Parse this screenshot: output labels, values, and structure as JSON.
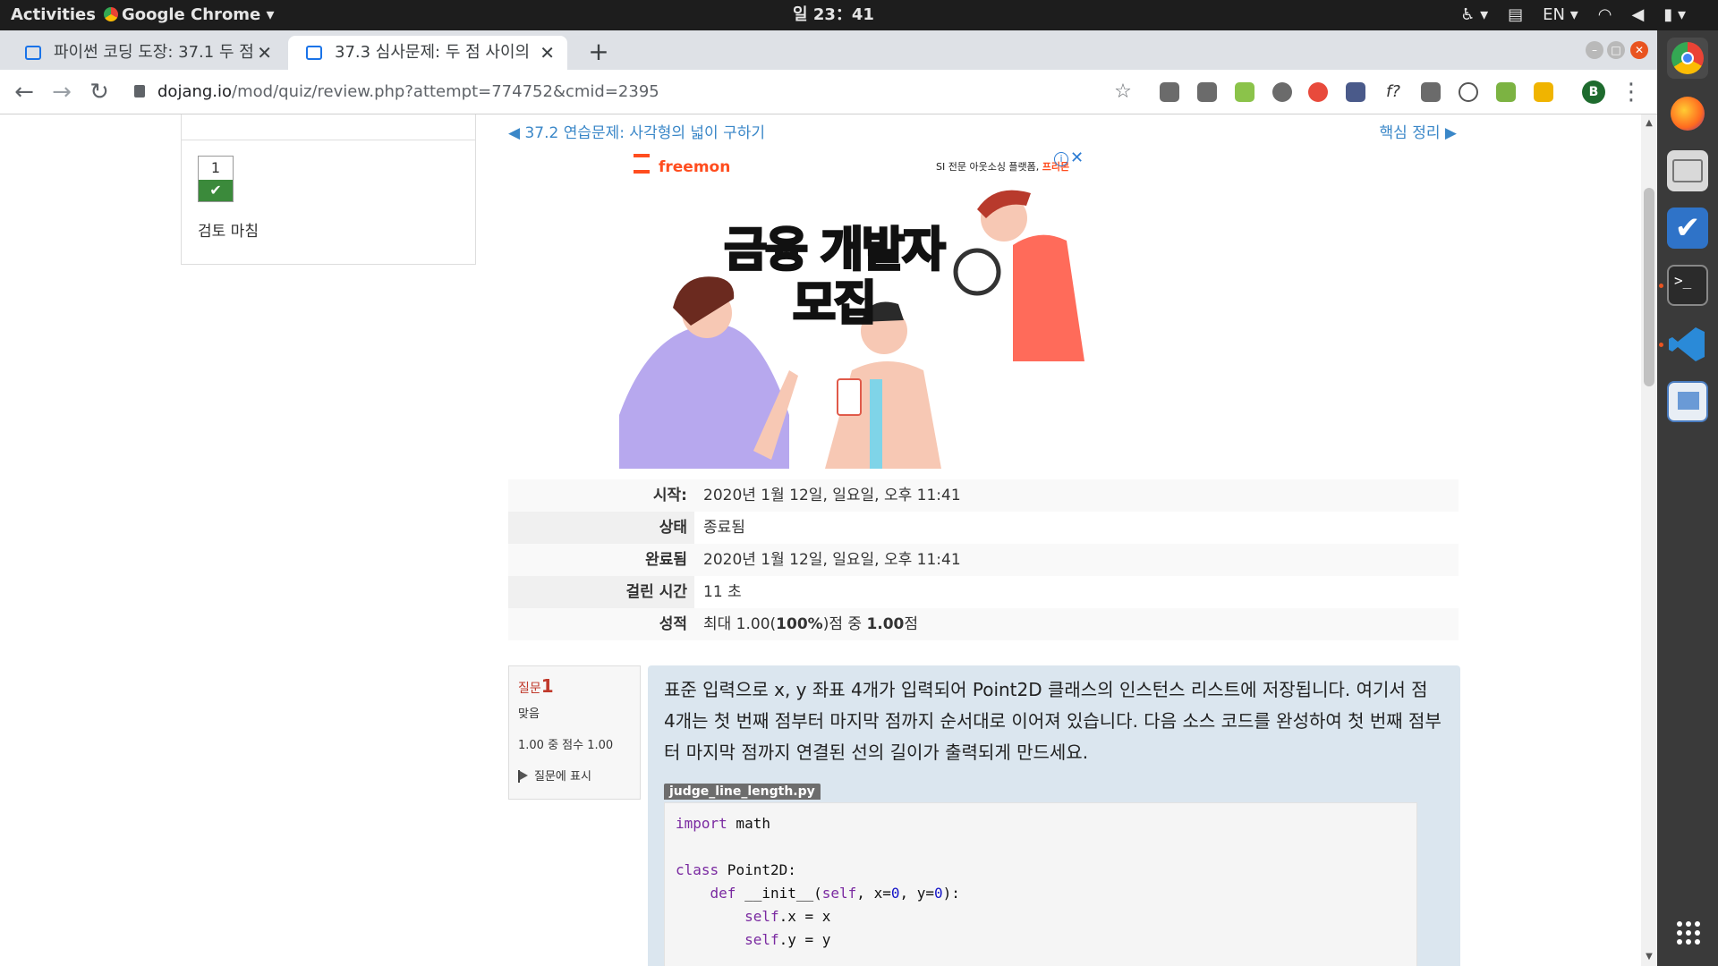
{
  "topbar": {
    "activities": "Activities",
    "app_name": "Google Chrome",
    "clock": "일 23：41",
    "lang": "EN"
  },
  "tabs": [
    {
      "label": "파이썬 코딩 도장: 37.1 두 점",
      "active": false
    },
    {
      "label": "37.3 심사문제: 두 점 사이의",
      "active": true
    }
  ],
  "address": {
    "host": "dojang.io",
    "path": "/mod/quiz/review.php?attempt=774752&cmid=2395"
  },
  "profile_initial": "B",
  "nav_panel": {
    "question_number": "1",
    "finish_review": "검토 마침"
  },
  "pager": {
    "prev": "◀ 37.2 연습문제: 사각형의 넓이 구하기",
    "next": "핵심 정리 ▶"
  },
  "ad": {
    "brand": "freemon",
    "tagline_prefix": "SI 전문 아웃소싱 플랫폼,",
    "tagline_brand": "프리몬",
    "headline_line1": "금융 개발자",
    "headline_line2": "모집"
  },
  "summary": [
    {
      "label": "시작:",
      "value": "2020년 1월 12일, 일요일, 오후 11:41"
    },
    {
      "label": "상태",
      "value": "종료됨"
    },
    {
      "label": "완료됨",
      "value": "2020년 1월 12일, 일요일, 오후 11:41"
    },
    {
      "label": "걸린 시간",
      "value": "11 초"
    }
  ],
  "grade_row": {
    "label": "성적",
    "prefix": "최대 1.00(",
    "percent": "100%",
    "middle": ")점 중 ",
    "score": "1.00",
    "suffix": "점"
  },
  "question_info": {
    "label": "질문",
    "number": "1",
    "state": "맞음",
    "grade": "1.00 중 점수 1.00",
    "flag": "질문에 표시"
  },
  "question": {
    "text": "표준 입력으로 x, y 좌표 4개가 입력되어 Point2D 클래스의 인스턴스 리스트에 저장됩니다. 여기서 점 4개는 첫 번째 점부터 마지막 점까지 순서대로 이어져 있습니다. 다음 소스 코드를 완성하여 첫 번째 점부터 마지막 점까지 연결된 선의 길이가 출력되게 만드세요.",
    "filename": "judge_line_length.py"
  },
  "colors": {
    "link": "#3a87c8",
    "correct": "#3b8a3b",
    "question_bg": "#dbe6ef",
    "ad_brand": "#ff4d1f"
  }
}
